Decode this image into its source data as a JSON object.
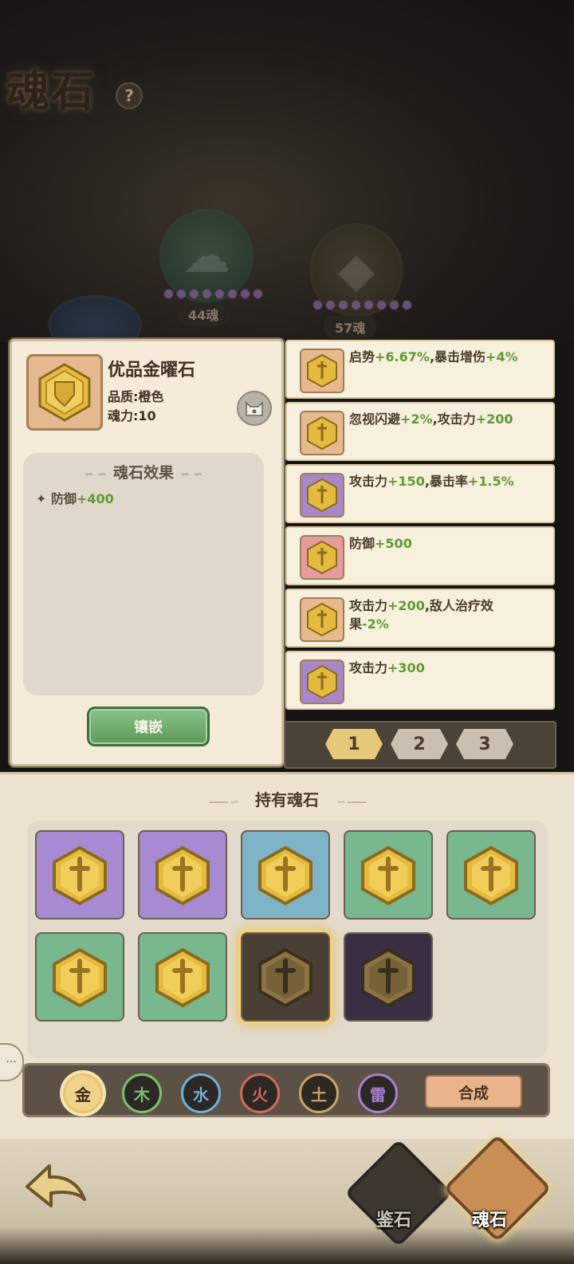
{
  "header": {
    "title": "魂石",
    "help_icon": "?"
  },
  "background_slots": [
    {
      "label": "44魂"
    },
    {
      "label": "57魂"
    }
  ],
  "detail": {
    "name": "优品金曜石",
    "quality": "品质:橙色",
    "power": "魂力:10",
    "effect_title": "魂石效果",
    "effect_bullet": "✦",
    "effect_stat": "防御",
    "effect_value": "+400",
    "inlay_label": "镶嵌"
  },
  "soul_list": [
    {
      "text": "启势",
      "val": "+6.67%",
      "text2": ",暴击增伤",
      "val2": "+4%",
      "color": "#e7b98d"
    },
    {
      "text": "忽视闪避",
      "val": "+2%",
      "text2": ",攻击力",
      "val2": "+200",
      "color": "#e7b98d"
    },
    {
      "text": "攻击力",
      "val": "+150",
      "text2": ",暴击率",
      "val2": "+1.5%",
      "color": "#a887c9"
    },
    {
      "text": "防御",
      "val": "+500",
      "text2": "",
      "val2": "",
      "color": "#e49c9c"
    },
    {
      "text": "攻击力",
      "val": "+200",
      "text2": ",敌人治疗效果",
      "val2": "-2%",
      "color": "#e7b98d"
    },
    {
      "text": "攻击力",
      "val": "+300",
      "text2": "",
      "val2": "",
      "color": "#a887c9"
    }
  ],
  "pager": {
    "pages": [
      "1",
      "2",
      "3"
    ],
    "active": 0
  },
  "owned": {
    "title": "持有魂石",
    "stones": [
      {
        "color": "#a78ad2"
      },
      {
        "color": "#a78ad2"
      },
      {
        "color": "#7fb3c8"
      },
      {
        "color": "#79b78e"
      },
      {
        "color": "#79b78e"
      },
      {
        "color": "#79b78e"
      },
      {
        "color": "#79b78e"
      },
      {
        "color": "#4a3f34"
      },
      {
        "color": "#3a2f45"
      }
    ],
    "selected_index": 7
  },
  "elements": [
    {
      "label": "金",
      "color": "#e6c46c"
    },
    {
      "label": "木",
      "color": "#79c070"
    },
    {
      "label": "水",
      "color": "#6fb0d8"
    },
    {
      "label": "火",
      "color": "#d06a5e"
    },
    {
      "label": "土",
      "color": "#c9a267"
    },
    {
      "label": "雷",
      "color": "#a97fd0"
    }
  ],
  "merge_label": "合成",
  "chat_icon": "···",
  "nav": {
    "appraise_label": "鉴石",
    "soulstone_label": "魂石"
  }
}
